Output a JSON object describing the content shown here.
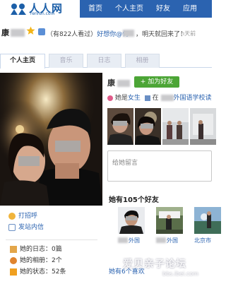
{
  "header": {
    "logo_text": "人人网",
    "logo_sub": "renren.com",
    "nav": [
      "首页",
      "个人主页",
      "好友",
      "应用"
    ]
  },
  "status": {
    "name_char": "康",
    "view_count": "（有822人看过）",
    "message_pre": "好想你@何",
    "message_post": "，明天就回来了！",
    "time_ago": "n天前"
  },
  "tabs": [
    "个人主页",
    "音乐",
    "日志",
    "相册"
  ],
  "left": {
    "actions": [
      "打招呼",
      "发站内信"
    ],
    "stats": [
      "她的日志：0篇",
      "她的相册：2个",
      "她的状态：52条"
    ]
  },
  "profile": {
    "name_char": "康",
    "add_friend": "+ 加为好友",
    "gender_prefix": "她是",
    "gender": "女生",
    "school_prefix": "在",
    "school": "外国语学校读",
    "message_placeholder": "给她留言",
    "friends_title": "她有105个好友",
    "friends": [
      {
        "label": "外国"
      },
      {
        "label": "外国"
      },
      {
        "label": "北京市"
      }
    ],
    "fav_title": "她有6个喜欢"
  },
  "watermark": {
    "main": "爱贝亲子论坛",
    "sub": "bbs.ibei.com"
  },
  "colors": {
    "nav_blue": "#2b63b0",
    "link_blue": "#2b63b0",
    "button_green": "#4ca536"
  }
}
